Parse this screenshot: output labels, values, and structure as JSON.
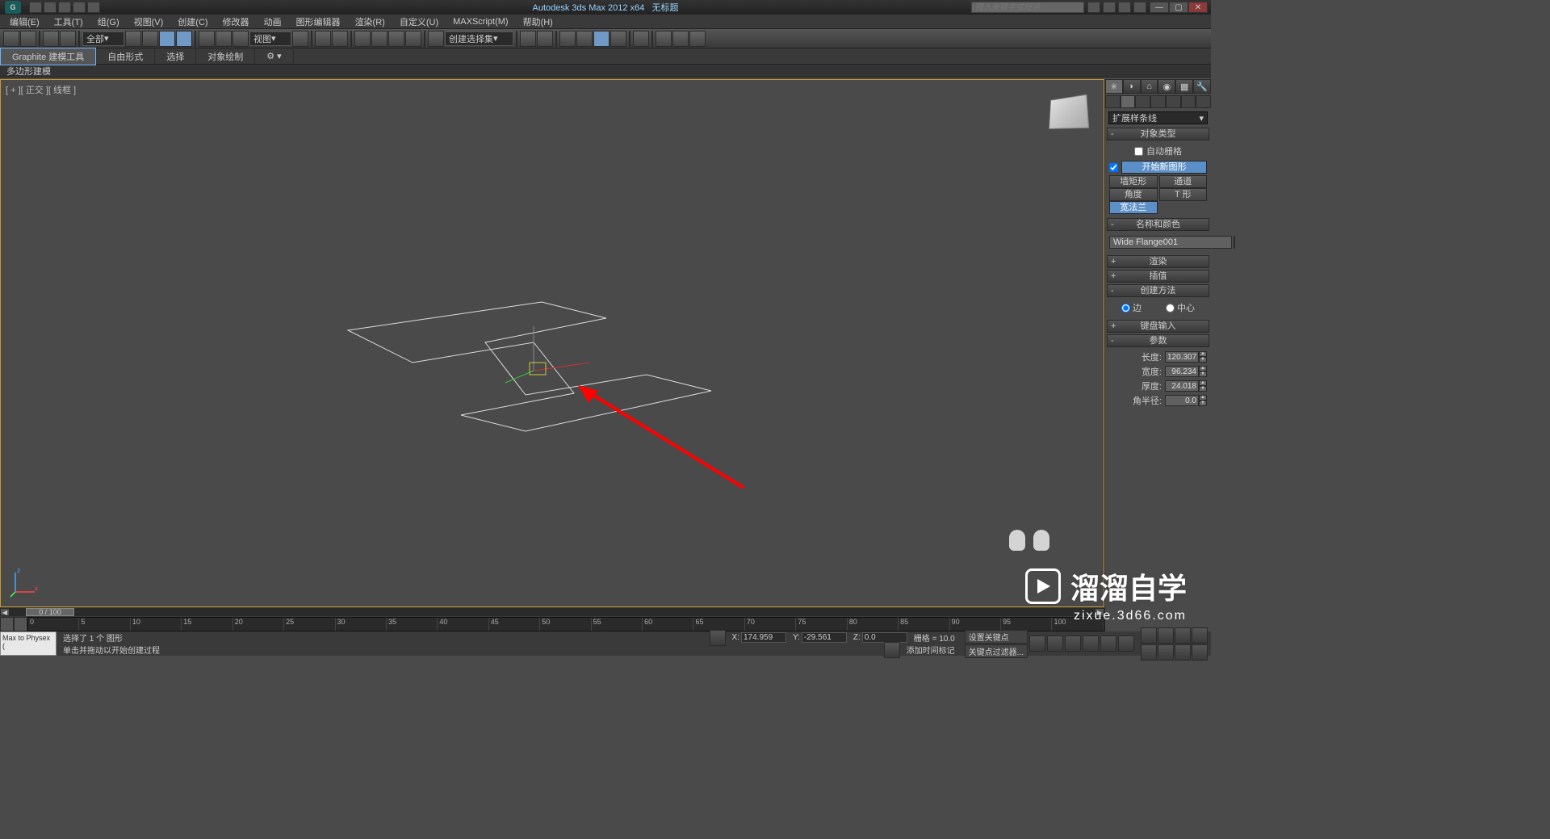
{
  "title": {
    "app": "Autodesk 3ds Max  2012 x64",
    "doc": "无标题"
  },
  "search": {
    "placeholder": "键入关键字或短语"
  },
  "menus": [
    "编辑(E)",
    "工具(T)",
    "组(G)",
    "视图(V)",
    "创建(C)",
    "修改器",
    "动画",
    "图形编辑器",
    "渲染(R)",
    "自定义(U)",
    "MAXScript(M)",
    "帮助(H)"
  ],
  "toolbar": {
    "filter_dropdown": "全部",
    "view_dropdown": "视图",
    "named_sel_dropdown": "创建选择集"
  },
  "ribbon": {
    "tabs": [
      "Graphite 建模工具",
      "自由形式",
      "选择",
      "对象绘制"
    ],
    "sub": "多边形建模"
  },
  "viewport": {
    "label": "[ + ][ 正交 ][ 线框 ]"
  },
  "cmdpanel": {
    "dropdown": "扩展样条线",
    "object_type": {
      "header": "对象类型",
      "autogrid": "自动栅格",
      "startnew": "开始新图形",
      "buttons": [
        [
          "墙矩形",
          "通道"
        ],
        [
          "角度",
          "T 形"
        ],
        [
          "宽法兰",
          ""
        ]
      ]
    },
    "name_color": {
      "header": "名称和颜色",
      "name": "Wide Flange001"
    },
    "rendering": "渲染",
    "interpolation": "插值",
    "creation_method": {
      "header": "创建方法",
      "edge": "边",
      "center": "中心"
    },
    "keyboard_entry": "键盘输入",
    "parameters": {
      "header": "参数",
      "length_label": "长度:",
      "length": "120.307",
      "width_label": "宽度:",
      "width": "96.234",
      "thickness_label": "厚度:",
      "thickness": "24.018",
      "corner_label": "角半径:",
      "corner": "0.0"
    }
  },
  "timeline": {
    "frame_display": "0 / 100",
    "ticks": [
      "0",
      "5",
      "10",
      "15",
      "20",
      "25",
      "30",
      "35",
      "40",
      "45",
      "50",
      "55",
      "60",
      "65",
      "70",
      "75",
      "80",
      "85",
      "90",
      "95",
      "100"
    ]
  },
  "status": {
    "script": "Max to Physex (",
    "line1": "选择了 1 个 图形",
    "line2": "单击并拖动以开始创建过程",
    "x": "174.959",
    "y": "-29.561",
    "z": "0.0",
    "grid": "栅格 = 10.0",
    "addtime": "添加时间标记",
    "setkey": "设置关键点",
    "keyfilter": "关键点过滤器..."
  },
  "watermark": {
    "text": "溜溜自学",
    "url": "zixue.3d66.com"
  }
}
